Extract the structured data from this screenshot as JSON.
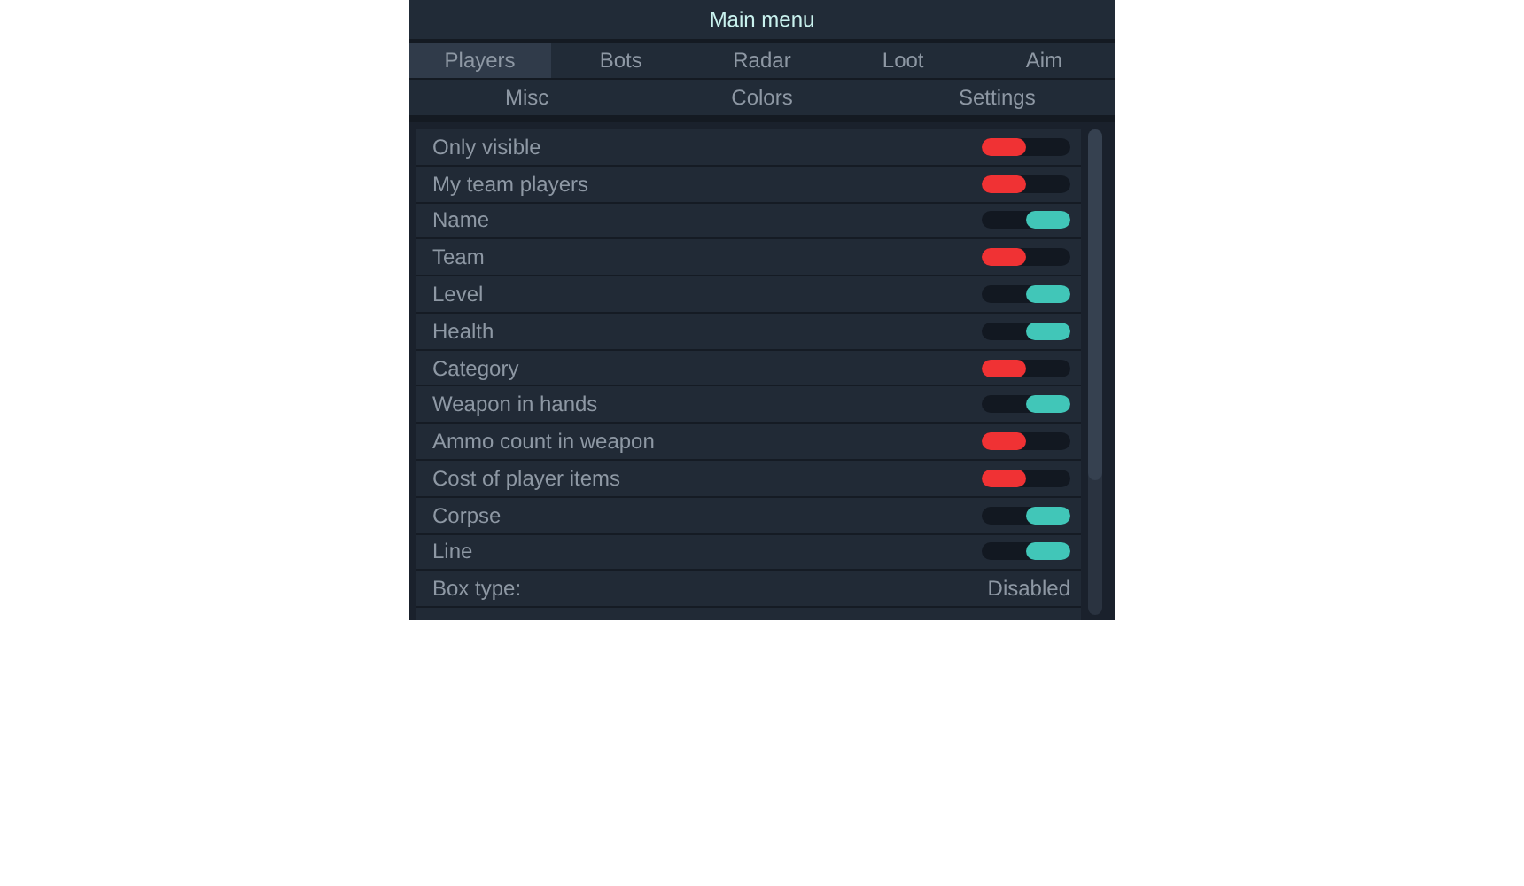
{
  "window": {
    "title": "Main menu"
  },
  "tabs": [
    [
      {
        "label": "Players",
        "selected": true
      },
      {
        "label": "Bots",
        "selected": false
      },
      {
        "label": "Radar",
        "selected": false
      },
      {
        "label": "Loot",
        "selected": false
      },
      {
        "label": "Aim",
        "selected": false
      }
    ],
    [
      {
        "label": "Misc",
        "selected": false
      },
      {
        "label": "Colors",
        "selected": false
      },
      {
        "label": "Settings",
        "selected": false
      }
    ]
  ],
  "options": [
    {
      "kind": "toggle",
      "label": "Only visible",
      "on": false
    },
    {
      "kind": "toggle",
      "label": "My team players",
      "on": false
    },
    {
      "kind": "toggle",
      "label": "Name",
      "on": true
    },
    {
      "kind": "toggle",
      "label": "Team",
      "on": false
    },
    {
      "kind": "toggle",
      "label": "Level",
      "on": true
    },
    {
      "kind": "toggle",
      "label": "Health",
      "on": true
    },
    {
      "kind": "toggle",
      "label": "Category",
      "on": false
    },
    {
      "kind": "toggle",
      "label": "Weapon in hands",
      "on": true
    },
    {
      "kind": "toggle",
      "label": "Ammo count in weapon",
      "on": false
    },
    {
      "kind": "toggle",
      "label": "Cost of player items",
      "on": false
    },
    {
      "kind": "toggle",
      "label": "Corpse",
      "on": true
    },
    {
      "kind": "toggle",
      "label": "Line",
      "on": true
    },
    {
      "kind": "select",
      "label": "Box type:",
      "value": "Disabled"
    }
  ]
}
